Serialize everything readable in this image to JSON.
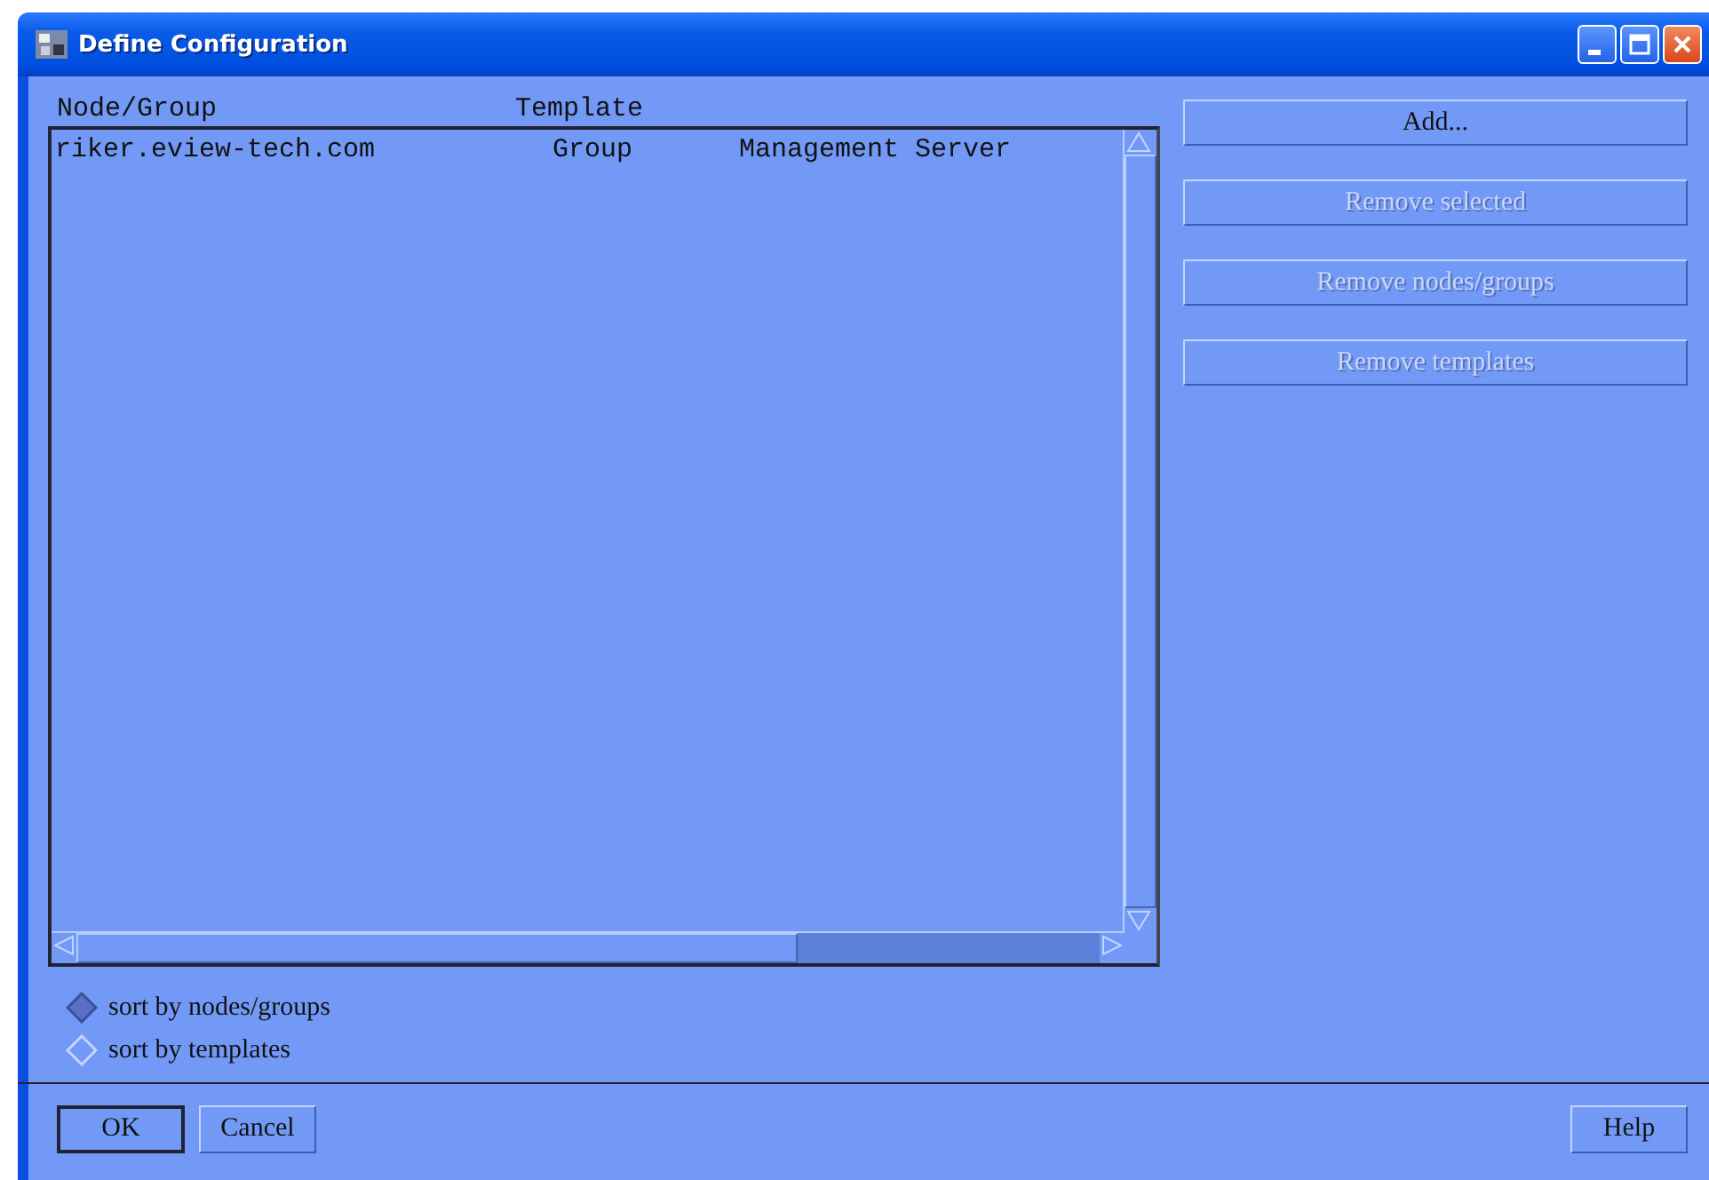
{
  "window": {
    "title": "Define Configuration"
  },
  "table": {
    "columns": [
      "Node/Group",
      "Template"
    ],
    "rows": [
      {
        "cells": [
          "riker.eview-tech.com",
          "Group",
          "Management Server"
        ]
      }
    ]
  },
  "side_buttons": [
    {
      "label": "Add...",
      "disabled": false
    },
    {
      "label": "Remove selected",
      "disabled": true
    },
    {
      "label": "Remove nodes/groups",
      "disabled": true
    },
    {
      "label": "Remove templates",
      "disabled": true
    }
  ],
  "sort_options": [
    {
      "label": "sort by nodes/groups",
      "selected": true
    },
    {
      "label": "sort by templates",
      "selected": false
    }
  ],
  "footer_buttons": [
    {
      "label": "OK",
      "kind": "default"
    },
    {
      "label": "Cancel",
      "kind": "normal"
    },
    {
      "label": "Help",
      "kind": "normal"
    }
  ]
}
